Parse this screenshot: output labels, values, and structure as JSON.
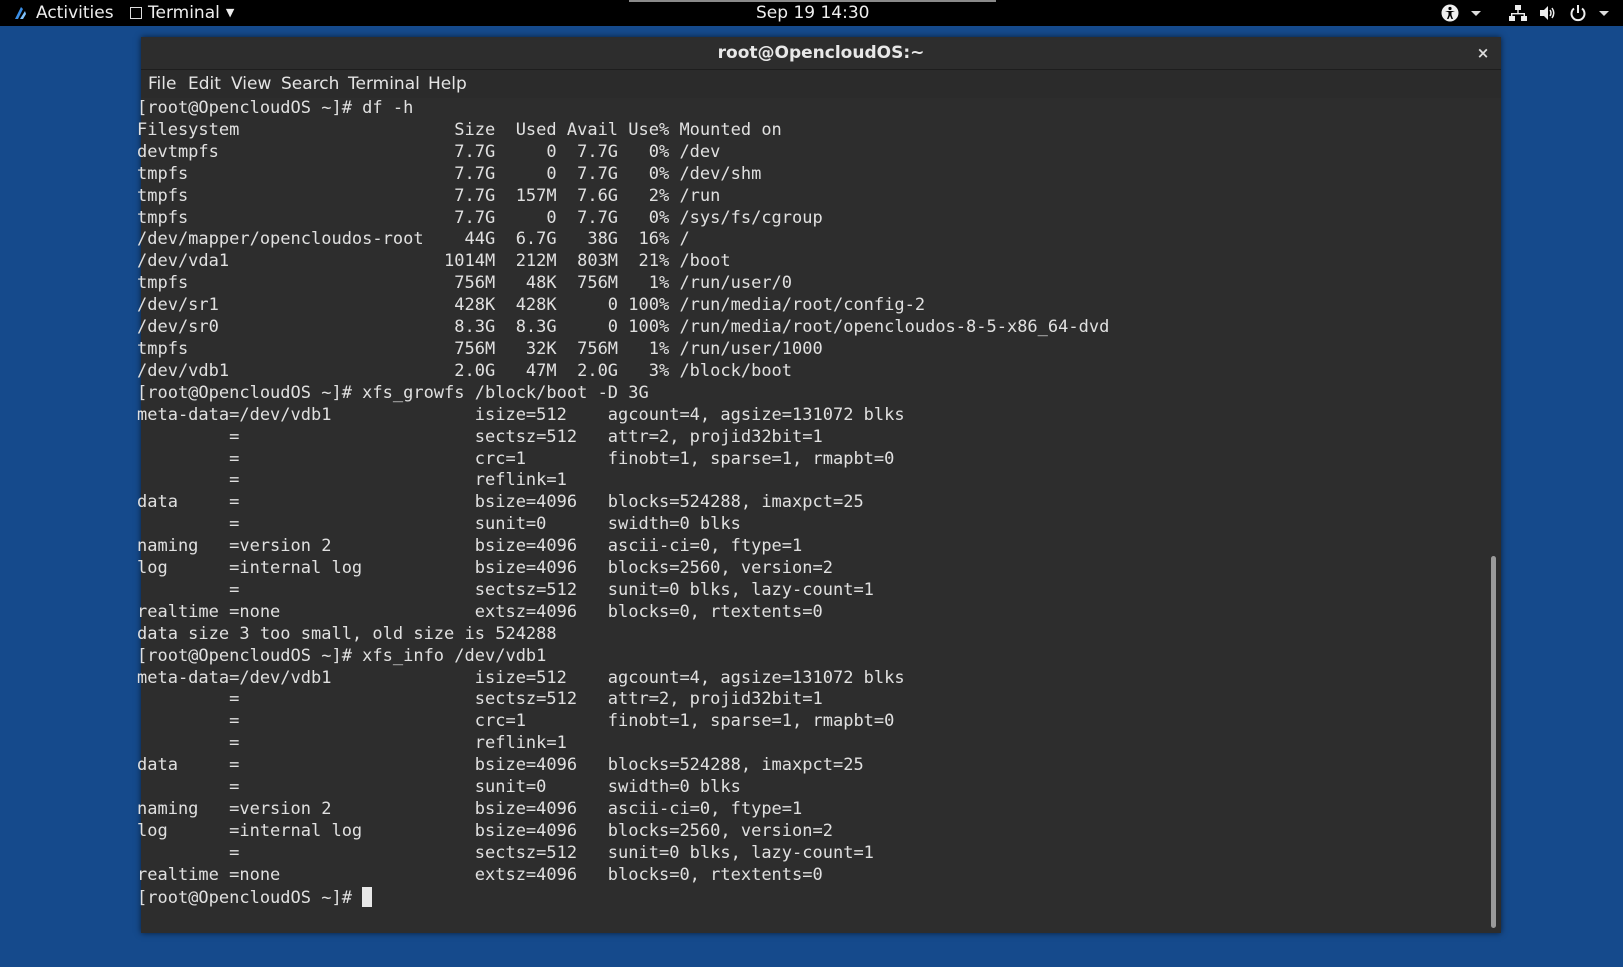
{
  "topbar": {
    "activities_label": "Activities",
    "app_menu_label": "Terminal",
    "clock": "Sep 19  14:30",
    "icons": [
      "distro-logo-icon",
      "accessibility-icon",
      "network-icon",
      "volume-icon",
      "power-icon"
    ]
  },
  "window": {
    "title": "root@OpencloudOS:~",
    "close_glyph": "×",
    "menu": [
      "File",
      "Edit",
      "View",
      "Search",
      "Terminal",
      "Help"
    ]
  },
  "terminal": {
    "lines": [
      "[root@OpencloudOS ~]# df -h",
      "Filesystem                     Size  Used Avail Use% Mounted on",
      "devtmpfs                       7.7G     0  7.7G   0% /dev",
      "tmpfs                          7.7G     0  7.7G   0% /dev/shm",
      "tmpfs                          7.7G  157M  7.6G   2% /run",
      "tmpfs                          7.7G     0  7.7G   0% /sys/fs/cgroup",
      "/dev/mapper/opencloudos-root    44G  6.7G   38G  16% /",
      "/dev/vda1                     1014M  212M  803M  21% /boot",
      "tmpfs                          756M   48K  756M   1% /run/user/0",
      "/dev/sr1                       428K  428K     0 100% /run/media/root/config-2",
      "/dev/sr0                       8.3G  8.3G     0 100% /run/media/root/opencloudos-8-5-x86_64-dvd",
      "tmpfs                          756M   32K  756M   1% /run/user/1000",
      "/dev/vdb1                      2.0G   47M  2.0G   3% /block/boot",
      "[root@OpencloudOS ~]# xfs_growfs /block/boot -D 3G",
      "meta-data=/dev/vdb1              isize=512    agcount=4, agsize=131072 blks",
      "         =                       sectsz=512   attr=2, projid32bit=1",
      "         =                       crc=1        finobt=1, sparse=1, rmapbt=0",
      "         =                       reflink=1",
      "data     =                       bsize=4096   blocks=524288, imaxpct=25",
      "         =                       sunit=0      swidth=0 blks",
      "naming   =version 2              bsize=4096   ascii-ci=0, ftype=1",
      "log      =internal log           bsize=4096   blocks=2560, version=2",
      "         =                       sectsz=512   sunit=0 blks, lazy-count=1",
      "realtime =none                   extsz=4096   blocks=0, rtextents=0",
      "data size 3 too small, old size is 524288",
      "[root@OpencloudOS ~]# xfs_info /dev/vdb1",
      "meta-data=/dev/vdb1              isize=512    agcount=4, agsize=131072 blks",
      "         =                       sectsz=512   attr=2, projid32bit=1",
      "         =                       crc=1        finobt=1, sparse=1, rmapbt=0",
      "         =                       reflink=1",
      "data     =                       bsize=4096   blocks=524288, imaxpct=25",
      "         =                       sunit=0      swidth=0 blks",
      "naming   =version 2              bsize=4096   ascii-ci=0, ftype=1",
      "log      =internal log           bsize=4096   blocks=2560, version=2",
      "         =                       sectsz=512   sunit=0 blks, lazy-count=1",
      "realtime =none                   extsz=4096   blocks=0, rtextents=0"
    ],
    "prompt": "[root@OpencloudOS ~]# "
  },
  "colors": {
    "desktop": "#154a8c",
    "topbar": "#000000",
    "terminal_bg": "#2d2d2d",
    "terminal_fg": "#e0e0e0"
  }
}
